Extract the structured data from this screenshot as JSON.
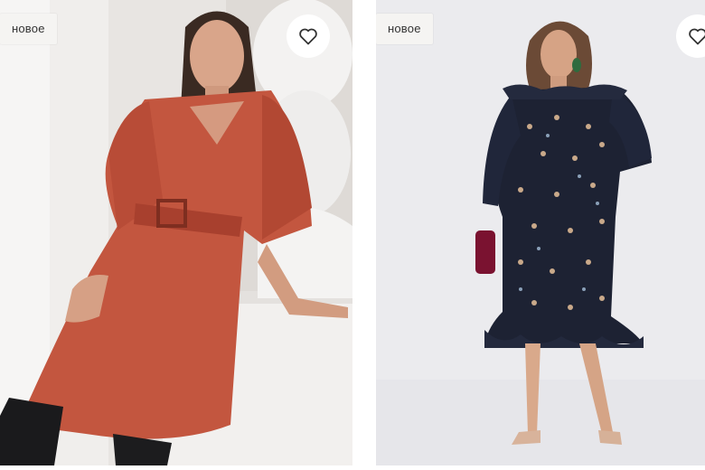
{
  "products": [
    {
      "badge": "новое",
      "image": "woman-in-rust-leather-belted-dress",
      "favorite_icon": "heart-outline-icon",
      "dress_color": "#c3563f",
      "background_color": "#e9e6e3"
    },
    {
      "badge": "новое",
      "image": "woman-in-dark-floral-ruffle-dress",
      "favorite_icon": "heart-outline-icon",
      "dress_color": "#1d2233",
      "background_color": "#ececef"
    }
  ]
}
